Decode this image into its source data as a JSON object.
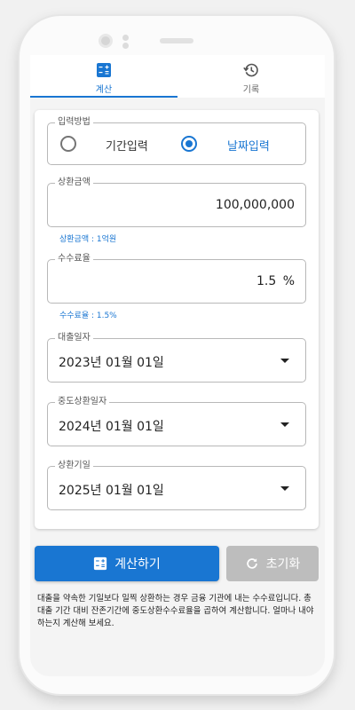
{
  "tabs": [
    {
      "label": "계산",
      "icon": "calculator-icon",
      "active": true
    },
    {
      "label": "기록",
      "icon": "history-icon",
      "active": false
    }
  ],
  "input_method": {
    "legend": "입력방법",
    "options": [
      {
        "label": "기간입력",
        "selected": false
      },
      {
        "label": "날짜입력",
        "selected": true
      }
    ]
  },
  "repayment_amount": {
    "legend": "상환금액",
    "value": "100,000,000",
    "helper": "상환금액 : 1억원"
  },
  "fee_rate": {
    "legend": "수수료율",
    "value": "1.5",
    "unit": "%",
    "helper": "수수료율 : 1.5%"
  },
  "loan_date": {
    "legend": "대출일자",
    "value": "2023년 01월 01일"
  },
  "prepayment_date": {
    "legend": "중도상환일자",
    "value": "2024년 01월 01일"
  },
  "maturity_date": {
    "legend": "상환기일",
    "value": "2025년 01월 01일"
  },
  "buttons": {
    "calculate": "계산하기",
    "reset": "초기화"
  },
  "description": "대출을 약속한 기일보다 일찍 상환하는 경우 금융 기관에 내는 수수료입니다. 총 대출 기간 대비 잔존기간에 중도상환수수료율을 곱하여 계산합니다. 얼마나 내야하는지 계산해 보세요.",
  "colors": {
    "accent": "#1976d2",
    "disabled": "#bdbdbd"
  }
}
